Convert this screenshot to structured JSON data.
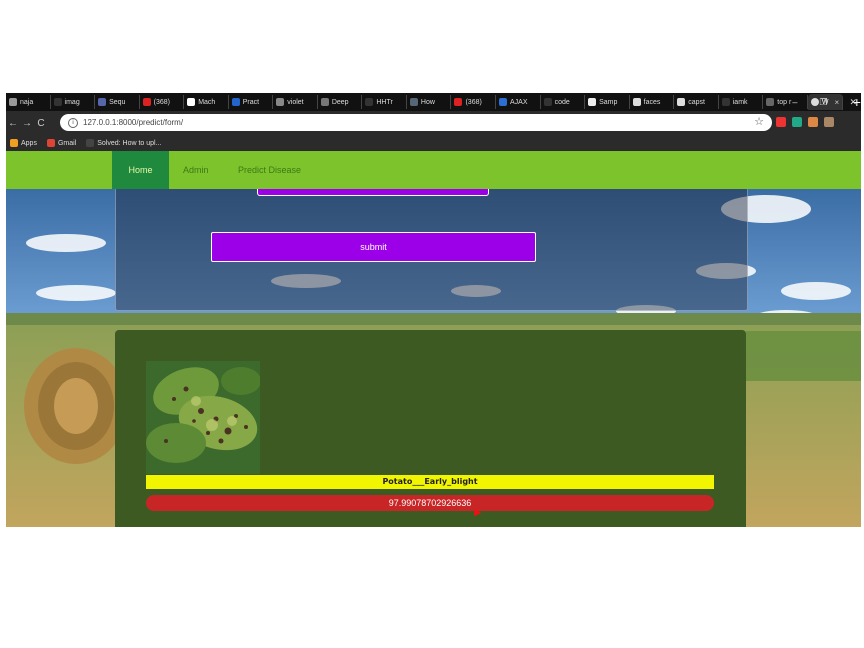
{
  "browser": {
    "tabs": [
      {
        "label": "naja",
        "color": "#999999"
      },
      {
        "label": "imag",
        "color": "#333333"
      },
      {
        "label": "Sequ",
        "color": "#5566aa"
      },
      {
        "label": "(368)",
        "color": "#dd2222"
      },
      {
        "label": "Mach",
        "color": "#ffffff"
      },
      {
        "label": "Pract",
        "color": "#2266cc"
      },
      {
        "label": "violet",
        "color": "#888888"
      },
      {
        "label": "Deep",
        "color": "#777777"
      },
      {
        "label": "HHTr",
        "color": "#333333"
      },
      {
        "label": "How",
        "color": "#556677"
      },
      {
        "label": "(368)",
        "color": "#dd2222"
      },
      {
        "label": "AJAX",
        "color": "#2a6fd1"
      },
      {
        "label": "code",
        "color": "#333333"
      },
      {
        "label": "Samp",
        "color": "#eeeeee"
      },
      {
        "label": "faces",
        "color": "#dddddd"
      },
      {
        "label": "capst",
        "color": "#dddddd"
      },
      {
        "label": "iamk",
        "color": "#333333"
      },
      {
        "label": "top r",
        "color": "#666666"
      }
    ],
    "active_tab": {
      "label": "W",
      "close": "×"
    },
    "new_tab_symbol": "+",
    "window_controls": [
      "–",
      "❐",
      "✕"
    ],
    "nav": {
      "back": "←",
      "forward": "→",
      "reload": "C"
    },
    "url": "127.0.0.1:8000/predict/form/",
    "bookmarks": [
      {
        "label": "Apps",
        "color": "#f0a020"
      },
      {
        "label": "Gmail",
        "color": "#dd4433"
      },
      {
        "label": "Solved: How to upl...",
        "color": "#444444"
      }
    ],
    "extension_colors": [
      "#e33",
      "#2a8",
      "#d84",
      "#a86"
    ]
  },
  "site": {
    "nav": {
      "home": "Home",
      "admin": "Admin",
      "predict": "Predict Disease"
    },
    "submit_label": "submit",
    "result": {
      "label": "Potato___Early_blight",
      "confidence": "97.99078702926636"
    }
  }
}
